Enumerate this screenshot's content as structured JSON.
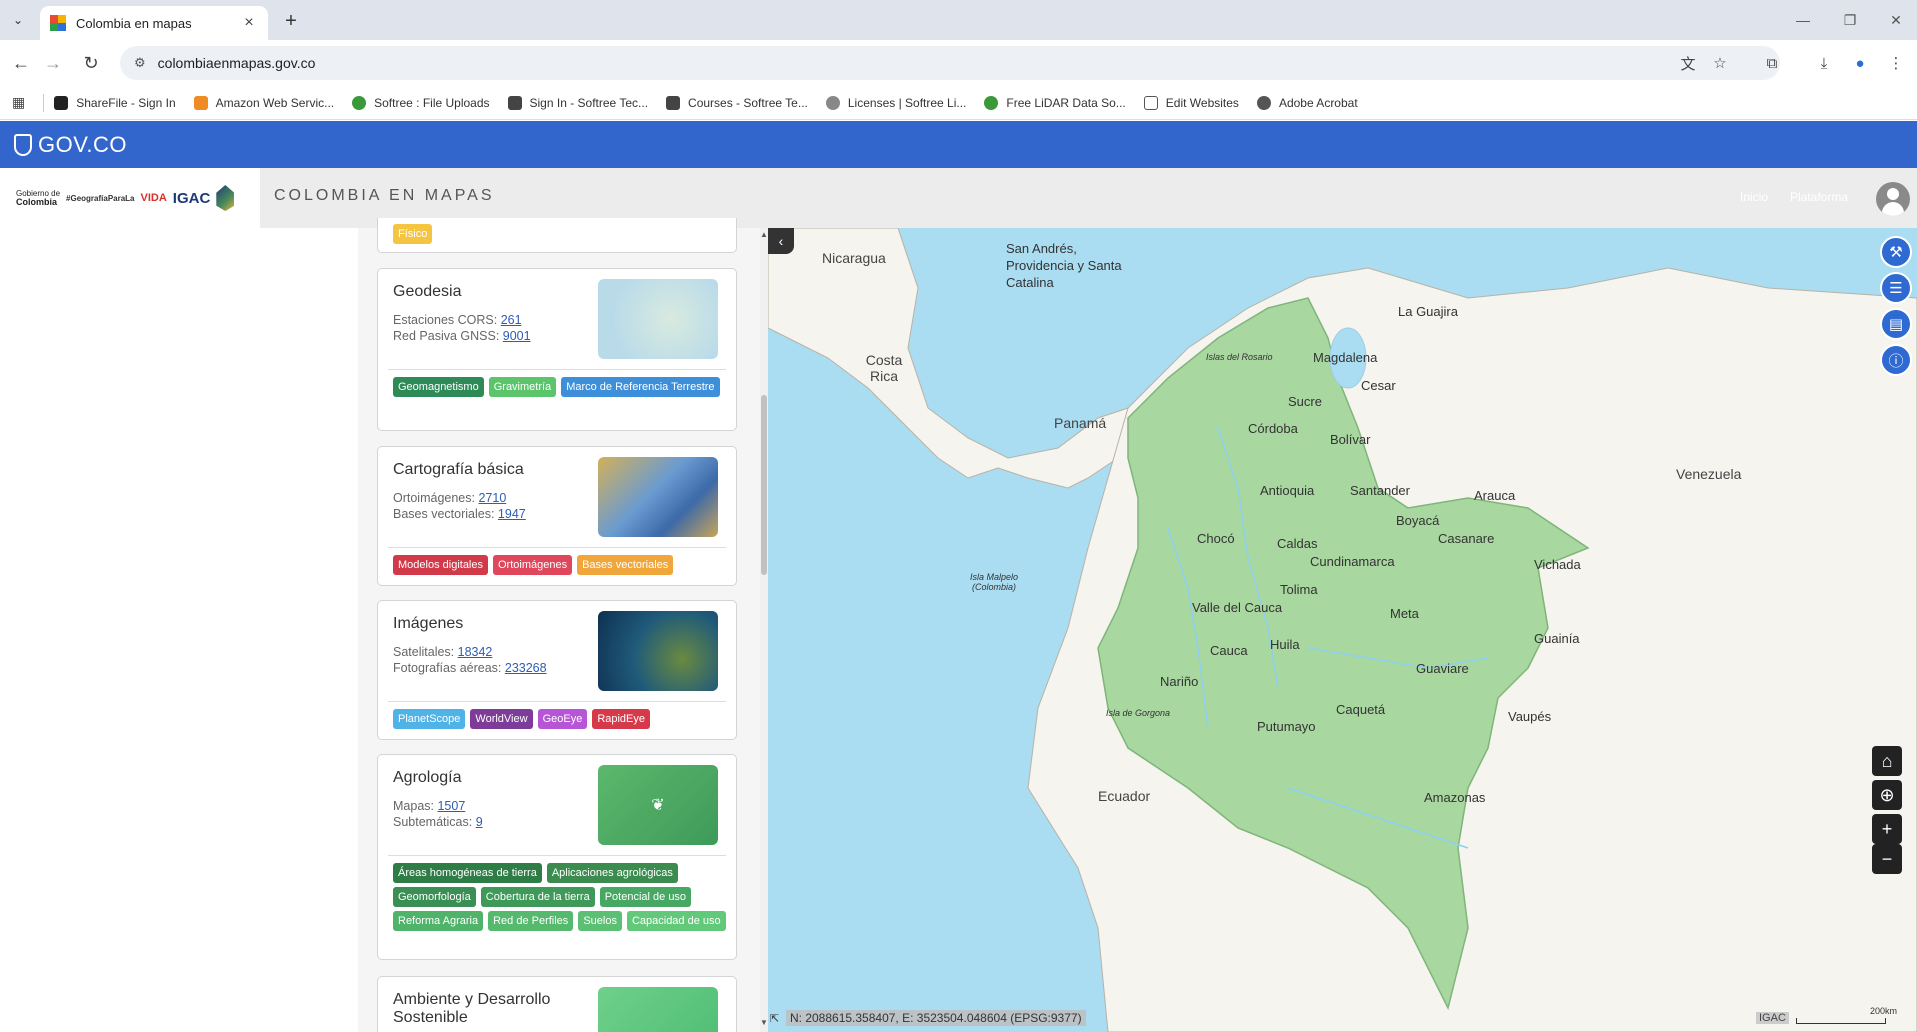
{
  "browser": {
    "tab_title": "Colombia en mapas",
    "url": "colombiaenmapas.gov.co",
    "bookmarks": [
      {
        "label": "ShareFile - Sign In",
        "color": "#222222"
      },
      {
        "label": "Amazon Web Servic...",
        "color": "#f08a24"
      },
      {
        "label": "Softree : File Uploads",
        "color": "#3a9a3a"
      },
      {
        "label": "Sign In - Softree Tec...",
        "color": "#444444"
      },
      {
        "label": "Courses - Softree Te...",
        "color": "#444444"
      },
      {
        "label": "Licenses | Softree Li...",
        "color": "#666666"
      },
      {
        "label": "Free LiDAR Data So...",
        "color": "#3a9a3a"
      },
      {
        "label": "Edit Websites",
        "color": "#555555"
      },
      {
        "label": "Adobe Acrobat",
        "color": "#555555"
      }
    ]
  },
  "govbar": {
    "label": "GOV.CO"
  },
  "header": {
    "logo_gobierno_line1": "Gobierno de",
    "logo_gobierno_line2": "Colombia",
    "logo_geografia": "#GeografíaParaLa",
    "logo_vida": "VIDA",
    "logo_igac": "IGAC",
    "title": "COLOMBIA EN MAPAS",
    "link_inicio": "Inicio",
    "link_plataforma": "Plataforma"
  },
  "panel": {
    "top_tag": "Físico",
    "cards": [
      {
        "title": "Geodesia",
        "line1_label": "Estaciones CORS: ",
        "line1_value": "261",
        "line2_label": "Red Pasiva GNSS: ",
        "line2_value": "9001",
        "tags": [
          {
            "label": "Geomagnetismo",
            "color": "#2e8b57"
          },
          {
            "label": "Gravimetría",
            "color": "#5cc46a"
          },
          {
            "label": "Marco de Referencia Terrestre",
            "color": "#3d8fd9"
          }
        ]
      },
      {
        "title": "Cartografía básica",
        "line1_label": "Ortoimágenes: ",
        "line1_value": "2710",
        "line2_label": "Bases vectoriales: ",
        "line2_value": "1947",
        "tags": [
          {
            "label": "Modelos digitales",
            "color": "#d23a4a"
          },
          {
            "label": "Ortoimágenes",
            "color": "#e0465c"
          },
          {
            "label": "Bases vectoriales",
            "color": "#f0a63a"
          }
        ]
      },
      {
        "title": "Imágenes",
        "line1_label": "Satelitales: ",
        "line1_value": "18342",
        "line2_label": "Fotografías aéreas: ",
        "line2_value": "233268",
        "tags": [
          {
            "label": "PlanetScope",
            "color": "#4fb3e8"
          },
          {
            "label": "WorldView",
            "color": "#7d3c98"
          },
          {
            "label": "GeoEye",
            "color": "#b656d6"
          },
          {
            "label": "RapidEye",
            "color": "#d63a4a"
          }
        ]
      },
      {
        "title": "Agrología",
        "line1_label": "Mapas: ",
        "line1_value": "1507",
        "line2_label": "Subtemáticas: ",
        "line2_value": "9",
        "tags": [
          {
            "label": "Áreas homogéneas de tierra",
            "color": "#2e7d46"
          },
          {
            "label": "Aplicaciones agrológicas",
            "color": "#3c8c50"
          },
          {
            "label": "Geomorfología",
            "color": "#3a8f55"
          },
          {
            "label": "Cobertura de la tierra",
            "color": "#3f9a5a"
          },
          {
            "label": "Potencial de uso",
            "color": "#46a862"
          },
          {
            "label": "Reforma Agraria",
            "color": "#4fb36a"
          },
          {
            "label": "Red de Perfiles",
            "color": "#55b96e"
          },
          {
            "label": "Suelos",
            "color": "#5cc074"
          },
          {
            "label": "Capacidad de uso",
            "color": "#62c87a"
          }
        ]
      },
      {
        "title": "Ambiente y Desarrollo Sostenible"
      }
    ]
  },
  "map": {
    "countries": [
      "Nicaragua",
      "Costa Rica",
      "Panamá",
      "Venezuela",
      "Ecuador"
    ],
    "island_labels": [
      "Islas del Rosario",
      "Isla Malpelo (Colombia)",
      "Isla de Gorgona"
    ],
    "region_san_andres": "San Andrés, Providencia y Santa Catalina",
    "departments": [
      "La Guajira",
      "Magdalena",
      "Cesar",
      "Sucre",
      "Córdoba",
      "Bolívar",
      "Antioquia",
      "Santander",
      "Arauca",
      "Boyacá",
      "Casanare",
      "Chocó",
      "Caldas",
      "Cundinamarca",
      "Vichada",
      "Tolima",
      "Valle del Cauca",
      "Meta",
      "Guainía",
      "Cauca",
      "Huila",
      "Guaviare",
      "Nariño",
      "Caquetá",
      "Vaupés",
      "Putumayo",
      "Amazonas"
    ],
    "coordinates": "N: 2088615.358407, E: 3523504.048604 (EPSG:9377)",
    "attribution": "IGAC",
    "scale_label": "200km",
    "colors": {
      "sea": "#aadcf2",
      "land": "#f6f4ee",
      "colombia": "#a8d7a0"
    }
  }
}
